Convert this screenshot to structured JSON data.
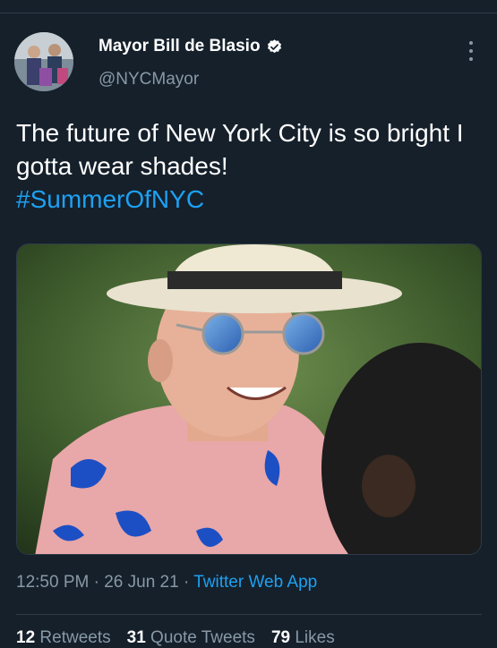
{
  "tweet": {
    "display_name": "Mayor Bill de Blasio",
    "handle": "@NYCMayor",
    "text": "The future of New York City is so bright I gotta wear shades!",
    "hashtag": "#SummerOfNYC",
    "time": "12:50 PM",
    "date": "26 Jun 21",
    "source": "Twitter Web App"
  },
  "stats": {
    "retweets_count": "12",
    "retweets_label": "Retweets",
    "quote_count": "31",
    "quote_label": "Quote Tweets",
    "likes_count": "79",
    "likes_label": "Likes"
  },
  "colors": {
    "background": "#15202b",
    "accent": "#1da1f2",
    "secondary_text": "#8899a6"
  },
  "icons": [
    "verified-badge-icon",
    "more-options-icon"
  ]
}
